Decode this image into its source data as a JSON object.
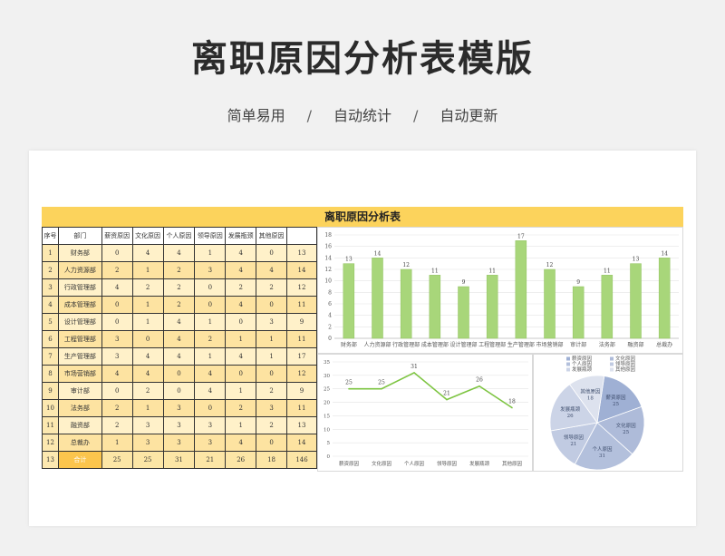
{
  "header": {
    "title": "离职原因分析表模版",
    "subtitle": [
      "简单易用",
      "自动统计",
      "自动更新"
    ],
    "separator": "/"
  },
  "sheet": {
    "banner": "离职原因分析表",
    "table": {
      "columns": [
        "序号",
        "部门",
        "薪资原因",
        "文化原因",
        "个人原因",
        "领导原因",
        "发展瓶颈",
        "其他原因",
        ""
      ],
      "rows": [
        [
          "1",
          "财务部",
          "0",
          "4",
          "4",
          "1",
          "4",
          "0",
          "13"
        ],
        [
          "2",
          "人力资源部",
          "2",
          "1",
          "2",
          "3",
          "4",
          "4",
          "14"
        ],
        [
          "3",
          "行政管理部",
          "4",
          "2",
          "2",
          "0",
          "2",
          "2",
          "12"
        ],
        [
          "4",
          "成本管理部",
          "0",
          "1",
          "2",
          "0",
          "4",
          "0",
          "11"
        ],
        [
          "5",
          "设计管理部",
          "0",
          "1",
          "4",
          "1",
          "0",
          "3",
          "9"
        ],
        [
          "6",
          "工程管理部",
          "3",
          "0",
          "4",
          "2",
          "1",
          "1",
          "11"
        ],
        [
          "7",
          "生产管理部",
          "3",
          "4",
          "4",
          "1",
          "4",
          "1",
          "17"
        ],
        [
          "8",
          "市场营销部",
          "4",
          "4",
          "0",
          "4",
          "0",
          "0",
          "12"
        ],
        [
          "9",
          "审计部",
          "0",
          "2",
          "0",
          "4",
          "1",
          "2",
          "9"
        ],
        [
          "10",
          "法务部",
          "2",
          "1",
          "3",
          "0",
          "2",
          "3",
          "11"
        ],
        [
          "11",
          "融资部",
          "2",
          "3",
          "3",
          "3",
          "1",
          "2",
          "13"
        ],
        [
          "12",
          "总裁办",
          "1",
          "3",
          "3",
          "3",
          "4",
          "0",
          "14"
        ]
      ],
      "total": [
        "13",
        "合计",
        "25",
        "25",
        "31",
        "21",
        "26",
        "18",
        "146"
      ]
    }
  },
  "chart_data": [
    {
      "type": "bar",
      "categories": [
        "财务部",
        "人力资源部",
        "行政管理部",
        "成本管理部",
        "设计管理部",
        "工程管理部",
        "生产管理部",
        "市场营销部",
        "审计部",
        "法务部",
        "融资部",
        "总裁办"
      ],
      "values": [
        13,
        14,
        12,
        11,
        9,
        11,
        17,
        12,
        9,
        11,
        13,
        14
      ],
      "ylim": [
        0,
        18
      ],
      "yticks": [
        0,
        2,
        4,
        6,
        8,
        10,
        12,
        14,
        16,
        18
      ],
      "color": "#a8d67a",
      "grid": true
    },
    {
      "type": "line",
      "categories": [
        "薪资原因",
        "文化原因",
        "个人原因",
        "领导原因",
        "发展瓶颈",
        "其他原因"
      ],
      "values": [
        25,
        25,
        31,
        21,
        26,
        18
      ],
      "ylim": [
        0,
        35
      ],
      "yticks": [
        0,
        5,
        10,
        15,
        20,
        25,
        30,
        35
      ],
      "color": "#7dc441",
      "grid": true
    },
    {
      "type": "pie",
      "categories": [
        "薪资原因",
        "文化原因",
        "个人原因",
        "领导原因",
        "发展瓶颈",
        "其他原因"
      ],
      "values": [
        25,
        25,
        31,
        21,
        26,
        18
      ],
      "legend": [
        "薪资原因",
        "文化原因",
        "个人原因",
        "领导原因",
        "发展瓶颈",
        "其他原因"
      ],
      "legend_position": "top",
      "colors": [
        "#9fb0d4",
        "#aebbd9",
        "#b3c0dc",
        "#c1cbe2",
        "#ccd4e7",
        "#dde2ee"
      ]
    }
  ]
}
